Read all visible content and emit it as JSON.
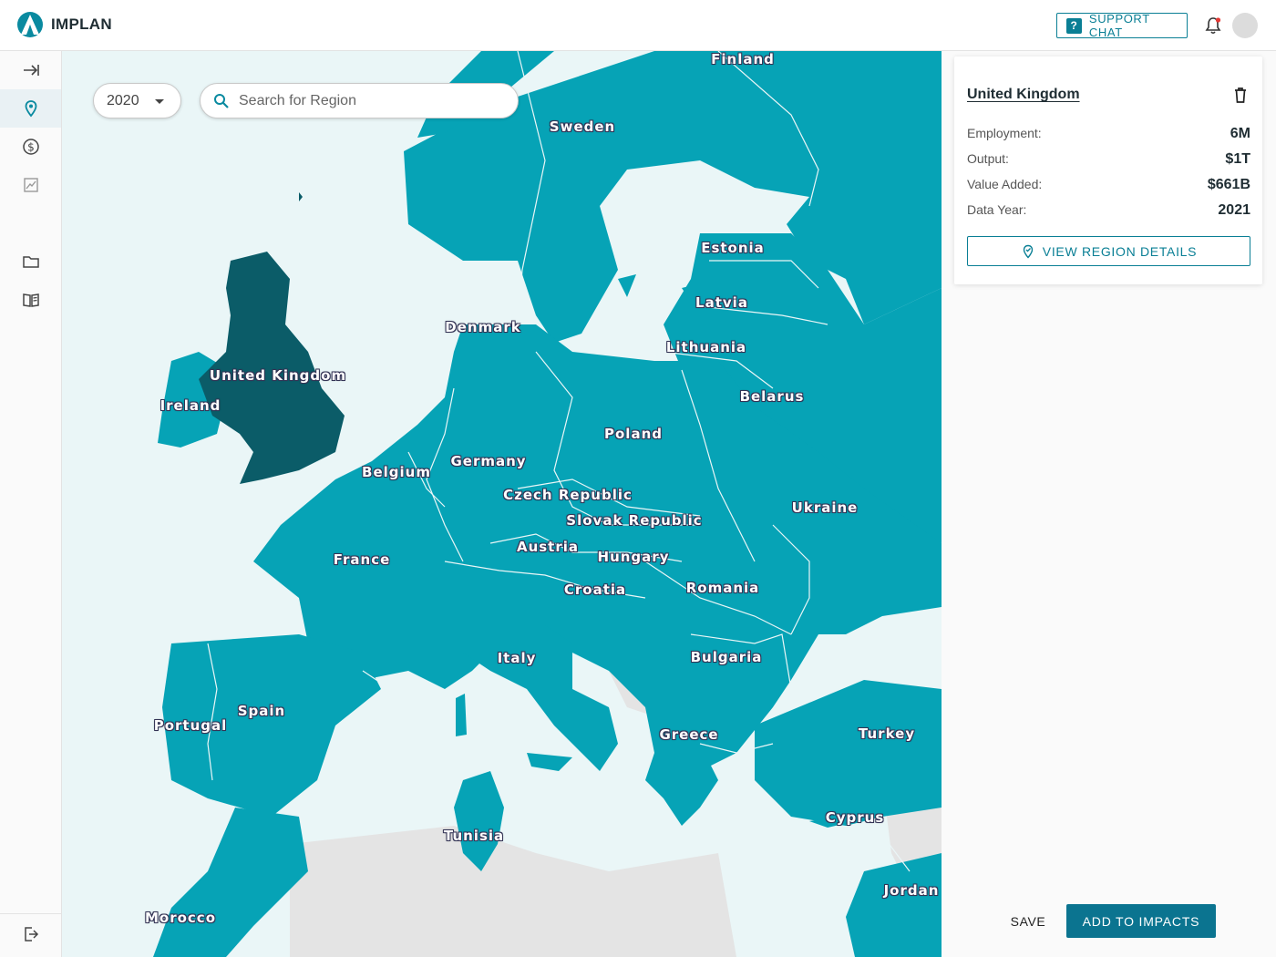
{
  "app": {
    "name": "IMPLAN"
  },
  "header": {
    "support_label": "SUPPORT CHAT"
  },
  "sidebar": {
    "items": [
      {
        "icon": "expand-sidebar-icon"
      },
      {
        "icon": "map-pin-icon",
        "active": true
      },
      {
        "icon": "dollar-icon"
      },
      {
        "icon": "chart-icon"
      },
      {
        "icon": "folder-icon"
      },
      {
        "icon": "book-icon"
      },
      {
        "icon": "logout-icon"
      }
    ]
  },
  "map": {
    "year": "2020",
    "search_placeholder": "Search for Region",
    "colors": {
      "country": "#06a3b6",
      "selected": "#0b5c68",
      "water": "#eaf6f7",
      "unavailable": "#e4e4e4"
    },
    "selected_country": "United Kingdom",
    "labels": {
      "finland": "Finland",
      "sweden": "Sweden",
      "estonia": "Estonia",
      "latvia": "Latvia",
      "denmark": "Denmark",
      "lithuania": "Lithuania",
      "united_kingdom": "United Kingdom",
      "ireland": "Ireland",
      "belarus": "Belarus",
      "poland": "Poland",
      "germany": "Germany",
      "belgium": "Belgium",
      "czech_republic": "Czech Republic",
      "slovak_republic": "Slovak Republic",
      "ukraine": "Ukraine",
      "austria": "Austria",
      "hungary": "Hungary",
      "france": "France",
      "croatia": "Croatia",
      "romania": "Romania",
      "italy": "Italy",
      "bulgaria": "Bulgaria",
      "spain": "Spain",
      "portugal": "Portugal",
      "greece": "Greece",
      "turkey": "Turkey",
      "cyprus": "Cyprus",
      "tunisia": "Tunisia",
      "jordan": "Jordan",
      "morocco": "Morocco"
    }
  },
  "region_card": {
    "title": "United Kingdom",
    "rows": [
      {
        "label": "Employment:",
        "value": "6M"
      },
      {
        "label": "Output:",
        "value": "$1T"
      },
      {
        "label": "Value Added:",
        "value": "$661B"
      },
      {
        "label": "Data Year:",
        "value": "2021"
      }
    ],
    "details_label": "VIEW REGION DETAILS"
  },
  "footer": {
    "save_label": "SAVE",
    "add_label": "ADD TO IMPACTS"
  }
}
